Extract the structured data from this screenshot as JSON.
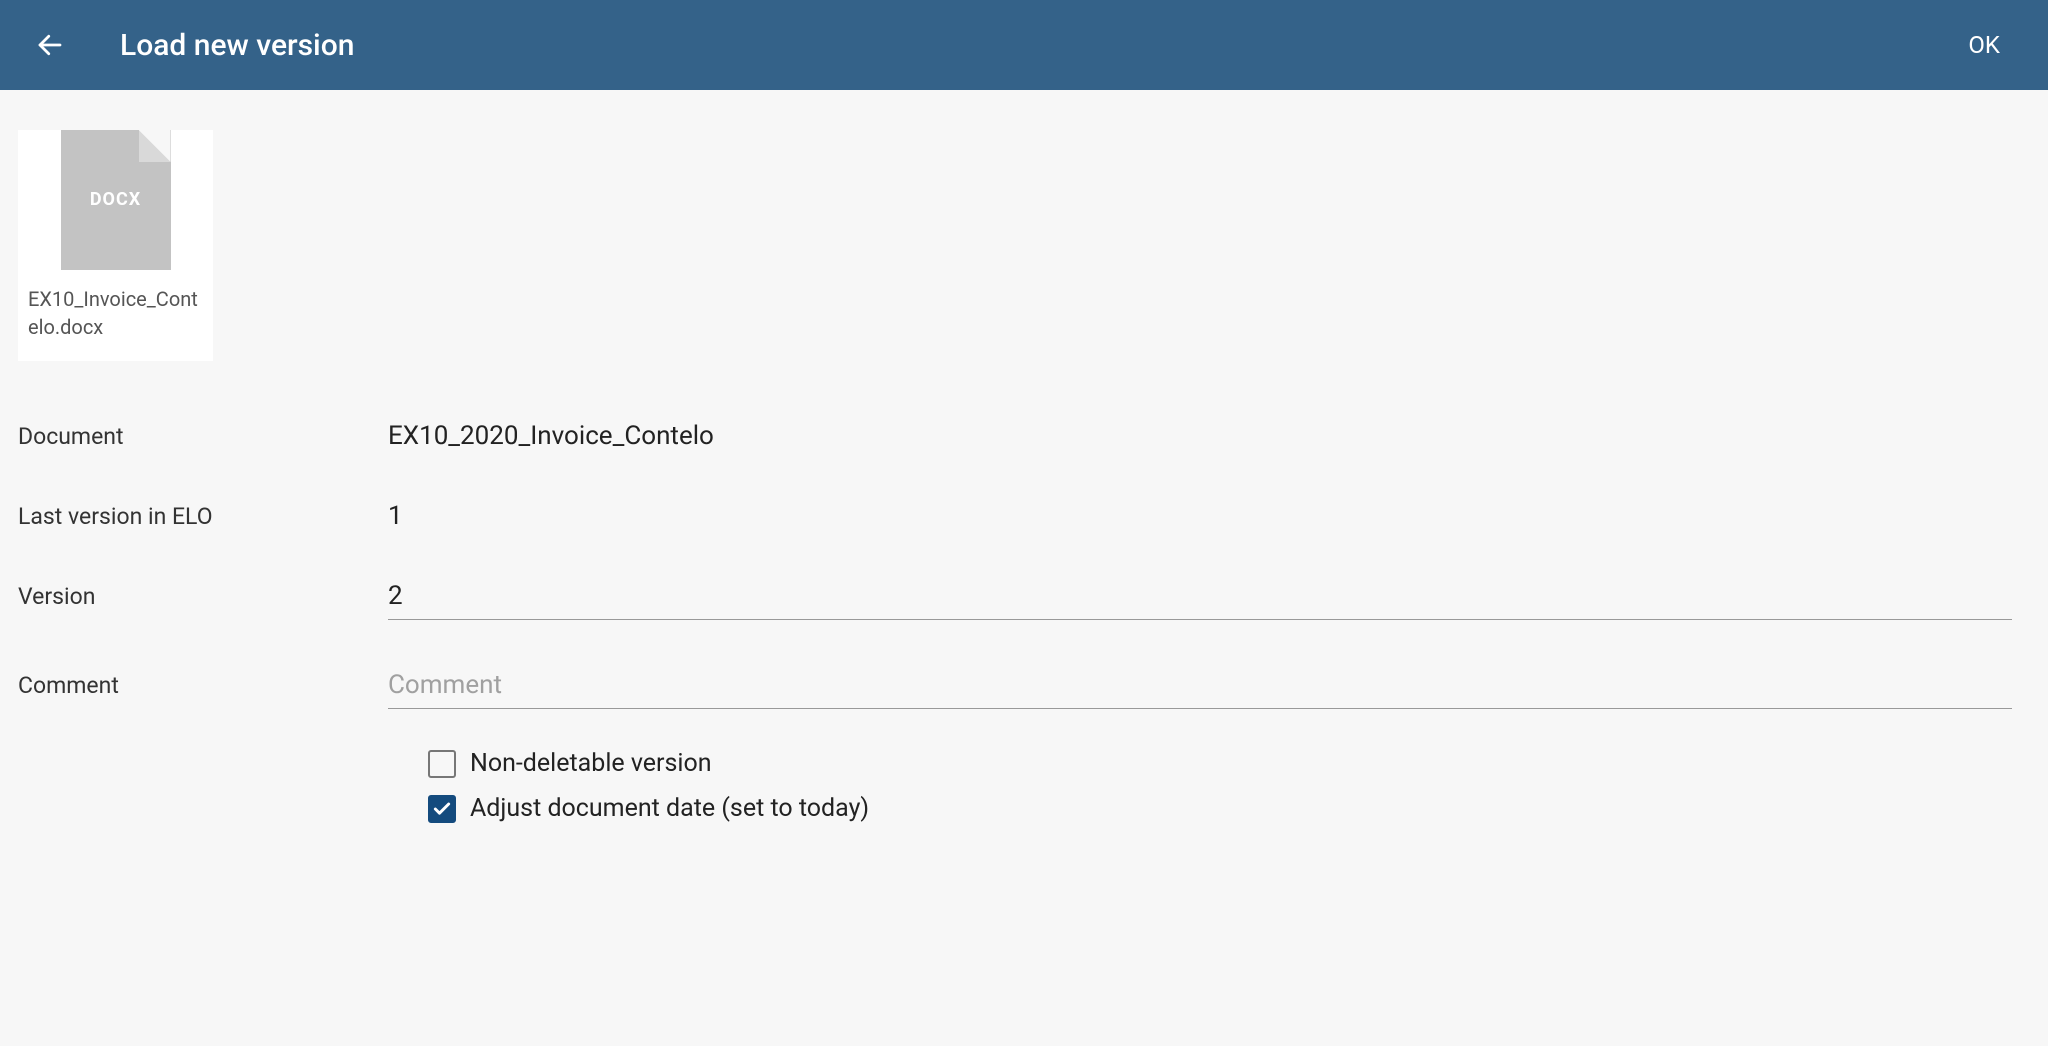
{
  "header": {
    "title": "Load new version",
    "ok_label": "OK"
  },
  "file": {
    "type_label": "DOCX",
    "filename": "EX10_Invoice_Contelo.docx"
  },
  "form": {
    "document_label": "Document",
    "document_value": "EX10_2020_Invoice_Contelo",
    "last_version_label": "Last version in ELO",
    "last_version_value": "1",
    "version_label": "Version",
    "version_value": "2",
    "comment_label": "Comment",
    "comment_placeholder": "Comment",
    "comment_value": ""
  },
  "checkboxes": {
    "non_deletable_label": "Non-deletable version",
    "non_deletable_checked": false,
    "adjust_date_label": "Adjust document date (set to today)",
    "adjust_date_checked": true
  }
}
